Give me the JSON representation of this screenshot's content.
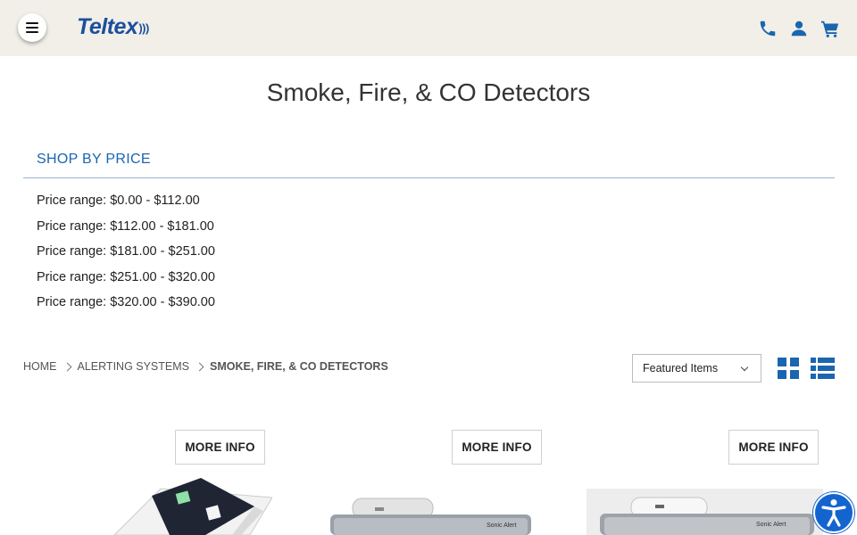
{
  "header": {
    "logo_text": "Teltex",
    "brand_color": "#1c4f9c",
    "icons": [
      "menu-icon",
      "phone-icon",
      "user-icon",
      "cart-icon"
    ]
  },
  "page": {
    "title": "Smoke, Fire, & CO Detectors"
  },
  "shop_by_price": {
    "heading": "SHOP BY PRICE",
    "ranges": [
      "Price range: $0.00 - $112.00",
      "Price range: $112.00 - $181.00",
      "Price range: $181.00 - $251.00",
      "Price range: $251.00 - $320.00",
      "Price range: $320.00 - $390.00"
    ]
  },
  "breadcrumb": {
    "items": [
      "HOME",
      "ALERTING SYSTEMS",
      "SMOKE, FIRE, & CO DETECTORS"
    ]
  },
  "sort": {
    "selected": "Featured Items"
  },
  "view_toggle": {
    "icons": [
      "grid-view-icon",
      "list-view-icon"
    ],
    "accent": "#1a65b0"
  },
  "products": [
    {
      "button_label": "MORE INFO",
      "label_text": ""
    },
    {
      "button_label": "MORE INFO",
      "label_text": "Sonic Alert"
    },
    {
      "button_label": "MORE INFO",
      "label_text": "Sonic Alert"
    }
  ],
  "accessibility": {
    "icon": "accessibility-icon",
    "color": "#1464d0"
  }
}
